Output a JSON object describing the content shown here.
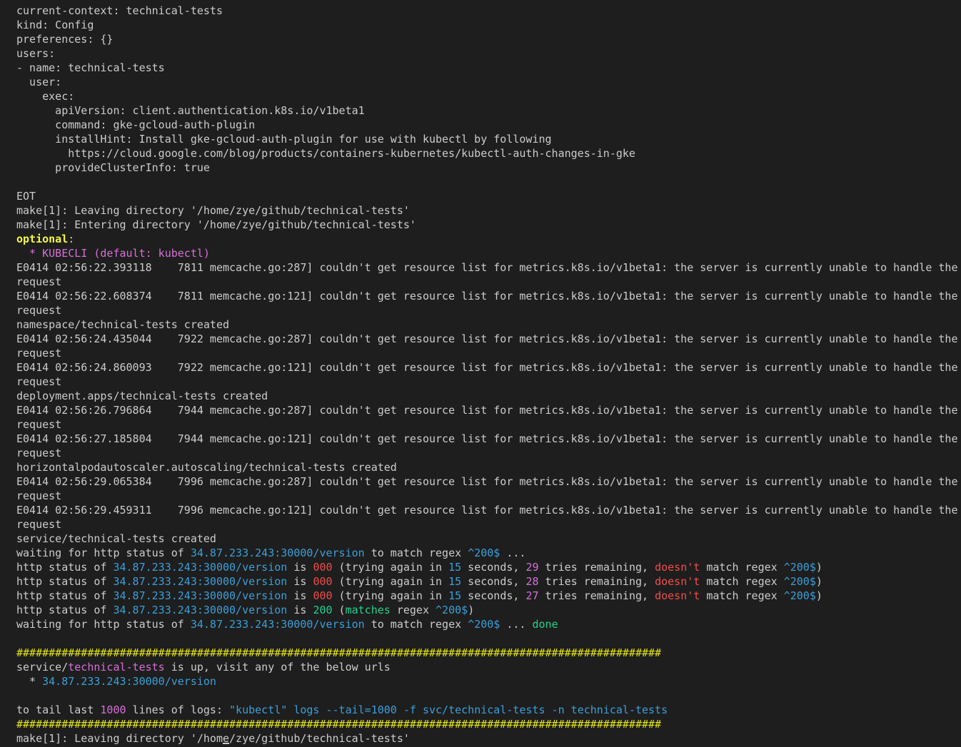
{
  "colors": {
    "background": "#1e1e1e",
    "default": "#cccccc",
    "blue": "#3b9fd8",
    "red": "#f14c4c",
    "magenta": "#d670d6",
    "green": "#23d18b",
    "yellow": "#e5e510",
    "yellowbold": "#f5f543"
  },
  "lines": [
    [
      {
        "t": "  name: technical-tests",
        "c": "default"
      }
    ],
    [
      {
        "t": "current-context: technical-tests",
        "c": "default"
      }
    ],
    [
      {
        "t": "kind: Config",
        "c": "default"
      }
    ],
    [
      {
        "t": "preferences: {}",
        "c": "default"
      }
    ],
    [
      {
        "t": "users:",
        "c": "default"
      }
    ],
    [
      {
        "t": "- name: technical-tests",
        "c": "default"
      }
    ],
    [
      {
        "t": "  user:",
        "c": "default"
      }
    ],
    [
      {
        "t": "    exec:",
        "c": "default"
      }
    ],
    [
      {
        "t": "      apiVersion: client.authentication.k8s.io/v1beta1",
        "c": "default"
      }
    ],
    [
      {
        "t": "      command: gke-gcloud-auth-plugin",
        "c": "default"
      }
    ],
    [
      {
        "t": "      installHint: Install gke-gcloud-auth-plugin for use with kubectl by following",
        "c": "default"
      }
    ],
    [
      {
        "t": "        https://cloud.google.com/blog/products/containers-kubernetes/kubectl-auth-changes-in-gke",
        "c": "default"
      }
    ],
    [
      {
        "t": "      provideClusterInfo: true",
        "c": "default"
      }
    ],
    [
      {
        "t": "",
        "c": "default"
      }
    ],
    [
      {
        "t": "EOT",
        "c": "default"
      }
    ],
    [
      {
        "t": "make[1]: Leaving directory '/home/zye/github/technical-tests'",
        "c": "default"
      }
    ],
    [
      {
        "t": "make[1]: Entering directory '/home/zye/github/technical-tests'",
        "c": "default"
      }
    ],
    [
      {
        "t": "optional",
        "c": "yellowbold"
      },
      {
        "t": ":",
        "c": "default"
      }
    ],
    [
      {
        "t": "  * KUBECLI (default: kubectl)",
        "c": "magenta"
      }
    ],
    [
      {
        "t": "E0414 02:56:22.393118    7811 memcache.go:287] couldn't get resource list for metrics.k8s.io/v1beta1: the server is currently unable to handle the",
        "c": "default"
      }
    ],
    [
      {
        "t": "request",
        "c": "default"
      }
    ],
    [
      {
        "t": "E0414 02:56:22.608374    7811 memcache.go:121] couldn't get resource list for metrics.k8s.io/v1beta1: the server is currently unable to handle the",
        "c": "default"
      }
    ],
    [
      {
        "t": "request",
        "c": "default"
      }
    ],
    [
      {
        "t": "namespace/technical-tests created",
        "c": "default"
      }
    ],
    [
      {
        "t": "E0414 02:56:24.435044    7922 memcache.go:287] couldn't get resource list for metrics.k8s.io/v1beta1: the server is currently unable to handle the",
        "c": "default"
      }
    ],
    [
      {
        "t": "request",
        "c": "default"
      }
    ],
    [
      {
        "t": "E0414 02:56:24.860093    7922 memcache.go:121] couldn't get resource list for metrics.k8s.io/v1beta1: the server is currently unable to handle the",
        "c": "default"
      }
    ],
    [
      {
        "t": "request",
        "c": "default"
      }
    ],
    [
      {
        "t": "deployment.apps/technical-tests created",
        "c": "default"
      }
    ],
    [
      {
        "t": "E0414 02:56:26.796864    7944 memcache.go:287] couldn't get resource list for metrics.k8s.io/v1beta1: the server is currently unable to handle the",
        "c": "default"
      }
    ],
    [
      {
        "t": "request",
        "c": "default"
      }
    ],
    [
      {
        "t": "E0414 02:56:27.185804    7944 memcache.go:121] couldn't get resource list for metrics.k8s.io/v1beta1: the server is currently unable to handle the",
        "c": "default"
      }
    ],
    [
      {
        "t": "request",
        "c": "default"
      }
    ],
    [
      {
        "t": "horizontalpodautoscaler.autoscaling/technical-tests created",
        "c": "default"
      }
    ],
    [
      {
        "t": "E0414 02:56:29.065384    7996 memcache.go:287] couldn't get resource list for metrics.k8s.io/v1beta1: the server is currently unable to handle the",
        "c": "default"
      }
    ],
    [
      {
        "t": "request",
        "c": "default"
      }
    ],
    [
      {
        "t": "E0414 02:56:29.459311    7996 memcache.go:121] couldn't get resource list for metrics.k8s.io/v1beta1: the server is currently unable to handle the",
        "c": "default"
      }
    ],
    [
      {
        "t": "request",
        "c": "default"
      }
    ],
    [
      {
        "t": "service/technical-tests created",
        "c": "default"
      }
    ],
    [
      {
        "t": "waiting for http status of ",
        "c": "default"
      },
      {
        "t": "34.87.233.243:30000/version",
        "c": "blue"
      },
      {
        "t": " to match regex ",
        "c": "default"
      },
      {
        "t": "^200$",
        "c": "blue"
      },
      {
        "t": " ...",
        "c": "default"
      }
    ],
    [
      {
        "t": "http status of ",
        "c": "default"
      },
      {
        "t": "34.87.233.243:30000/version",
        "c": "blue"
      },
      {
        "t": " is ",
        "c": "default"
      },
      {
        "t": "000",
        "c": "red"
      },
      {
        "t": " (trying again in ",
        "c": "default"
      },
      {
        "t": "15",
        "c": "blue"
      },
      {
        "t": " seconds, ",
        "c": "default"
      },
      {
        "t": "29",
        "c": "magenta"
      },
      {
        "t": " tries remaining, ",
        "c": "default"
      },
      {
        "t": "doesn't",
        "c": "red"
      },
      {
        "t": " match regex ",
        "c": "default"
      },
      {
        "t": "^200$",
        "c": "blue"
      },
      {
        "t": ")",
        "c": "default"
      }
    ],
    [
      {
        "t": "http status of ",
        "c": "default"
      },
      {
        "t": "34.87.233.243:30000/version",
        "c": "blue"
      },
      {
        "t": " is ",
        "c": "default"
      },
      {
        "t": "000",
        "c": "red"
      },
      {
        "t": " (trying again in ",
        "c": "default"
      },
      {
        "t": "15",
        "c": "blue"
      },
      {
        "t": " seconds, ",
        "c": "default"
      },
      {
        "t": "28",
        "c": "magenta"
      },
      {
        "t": " tries remaining, ",
        "c": "default"
      },
      {
        "t": "doesn't",
        "c": "red"
      },
      {
        "t": " match regex ",
        "c": "default"
      },
      {
        "t": "^200$",
        "c": "blue"
      },
      {
        "t": ")",
        "c": "default"
      }
    ],
    [
      {
        "t": "http status of ",
        "c": "default"
      },
      {
        "t": "34.87.233.243:30000/version",
        "c": "blue"
      },
      {
        "t": " is ",
        "c": "default"
      },
      {
        "t": "000",
        "c": "red"
      },
      {
        "t": " (trying again in ",
        "c": "default"
      },
      {
        "t": "15",
        "c": "blue"
      },
      {
        "t": " seconds, ",
        "c": "default"
      },
      {
        "t": "27",
        "c": "magenta"
      },
      {
        "t": " tries remaining, ",
        "c": "default"
      },
      {
        "t": "doesn't",
        "c": "red"
      },
      {
        "t": " match regex ",
        "c": "default"
      },
      {
        "t": "^200$",
        "c": "blue"
      },
      {
        "t": ")",
        "c": "default"
      }
    ],
    [
      {
        "t": "http status of ",
        "c": "default"
      },
      {
        "t": "34.87.233.243:30000/version",
        "c": "blue"
      },
      {
        "t": " is ",
        "c": "default"
      },
      {
        "t": "200",
        "c": "green"
      },
      {
        "t": " (",
        "c": "default"
      },
      {
        "t": "matches",
        "c": "green"
      },
      {
        "t": " regex ",
        "c": "default"
      },
      {
        "t": "^200$",
        "c": "blue"
      },
      {
        "t": ")",
        "c": "default"
      }
    ],
    [
      {
        "t": "waiting for http status of ",
        "c": "default"
      },
      {
        "t": "34.87.233.243:30000/version",
        "c": "blue"
      },
      {
        "t": " to match regex ",
        "c": "default"
      },
      {
        "t": "^200$",
        "c": "blue"
      },
      {
        "t": " ... ",
        "c": "default"
      },
      {
        "t": "done",
        "c": "green"
      }
    ],
    [
      {
        "t": "",
        "c": "default"
      }
    ],
    [
      {
        "t": "####################################################################################################",
        "c": "yellow"
      }
    ],
    [
      {
        "t": "service/",
        "c": "default"
      },
      {
        "t": "technical-tests",
        "c": "magenta"
      },
      {
        "t": " is up, visit any of the below urls",
        "c": "default"
      }
    ],
    [
      {
        "t": "  * ",
        "c": "default"
      },
      {
        "t": "34.87.233.243:30000/version",
        "c": "blue"
      }
    ],
    [
      {
        "t": "",
        "c": "default"
      }
    ],
    [
      {
        "t": "to tail last ",
        "c": "default"
      },
      {
        "t": "1000",
        "c": "magenta"
      },
      {
        "t": " lines of logs: ",
        "c": "default"
      },
      {
        "t": "\"kubectl\" logs --tail=1000 -f svc/technical-tests -n technical-tests",
        "c": "blue"
      }
    ],
    [
      {
        "t": "####################################################################################################",
        "c": "yellow"
      }
    ],
    [
      {
        "t": "make[1]: Leaving directory '/home/zye/github/technical-tests'",
        "c": "default"
      }
    ]
  ]
}
